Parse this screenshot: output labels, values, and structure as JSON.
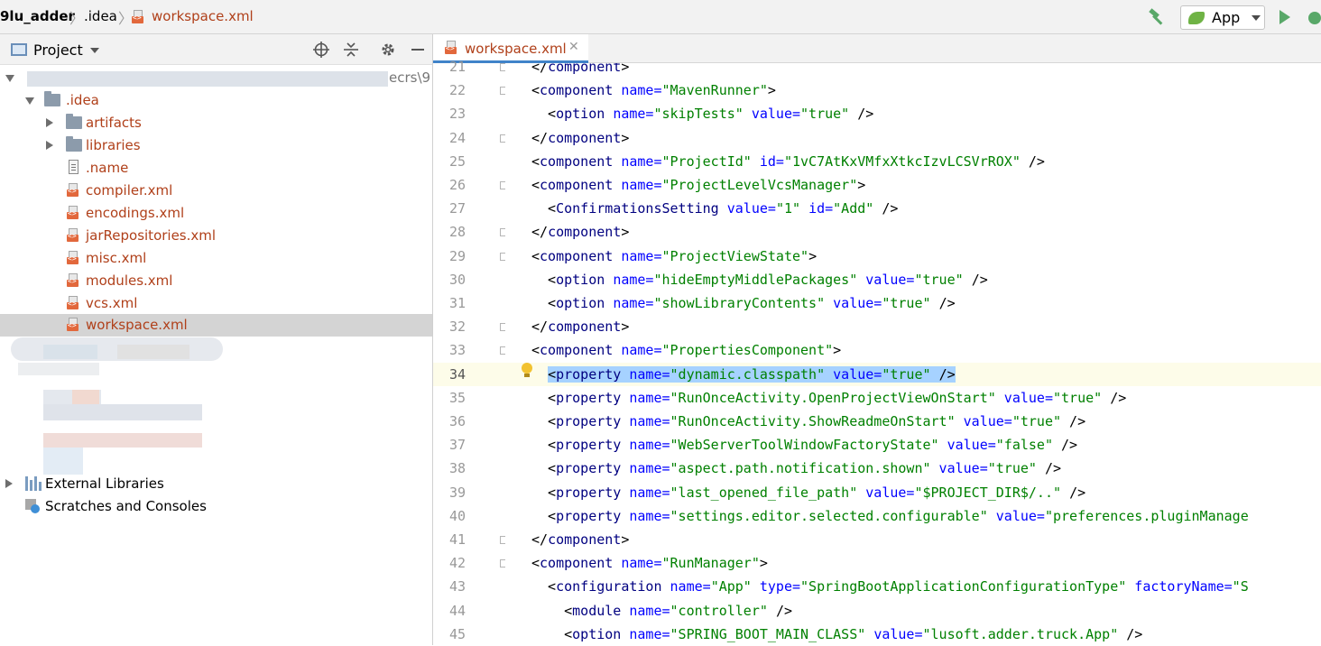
{
  "breadcrumb": {
    "project": "9lu_adder",
    "folder": ".idea",
    "file": "workspace.xml"
  },
  "toolbar": {
    "run_config": "App"
  },
  "project_panel": {
    "title": "Project",
    "root_suffix": "ecrs\\9",
    "tree": [
      {
        "label": ".idea",
        "kind": "folder",
        "expanded": true
      },
      {
        "label": "artifacts",
        "kind": "folder"
      },
      {
        "label": "libraries",
        "kind": "folder"
      },
      {
        "label": ".name",
        "kind": "text-file"
      },
      {
        "label": "compiler.xml",
        "kind": "xml-file"
      },
      {
        "label": "encodings.xml",
        "kind": "xml-file"
      },
      {
        "label": "jarRepositories.xml",
        "kind": "xml-file"
      },
      {
        "label": "misc.xml",
        "kind": "xml-file"
      },
      {
        "label": "modules.xml",
        "kind": "xml-file"
      },
      {
        "label": "vcs.xml",
        "kind": "xml-file"
      },
      {
        "label": "workspace.xml",
        "kind": "xml-file",
        "selected": true
      }
    ],
    "external_libraries": "External Libraries",
    "scratches": "Scratches and Consoles"
  },
  "editor": {
    "tab_title": "workspace.xml",
    "current_line": 34,
    "lines": [
      {
        "n": "21",
        "segs": [
          [
            "p",
            "</"
          ],
          [
            "t",
            "component"
          ],
          [
            "p",
            ">"
          ]
        ]
      },
      {
        "n": "22",
        "segs": [
          [
            "p",
            "<"
          ],
          [
            "t",
            "component "
          ],
          [
            "a",
            "name="
          ],
          [
            "v",
            "\"MavenRunner\""
          ],
          [
            "p",
            ">"
          ]
        ]
      },
      {
        "n": "23",
        "segs": [
          [
            "p",
            "  <"
          ],
          [
            "t",
            "option "
          ],
          [
            "a",
            "name="
          ],
          [
            "v",
            "\"skipTests\" "
          ],
          [
            "a",
            "value="
          ],
          [
            "v",
            "\"true\" "
          ],
          [
            "p",
            "/>"
          ]
        ]
      },
      {
        "n": "24",
        "segs": [
          [
            "p",
            "</"
          ],
          [
            "t",
            "component"
          ],
          [
            "p",
            ">"
          ]
        ]
      },
      {
        "n": "25",
        "segs": [
          [
            "p",
            "<"
          ],
          [
            "t",
            "component "
          ],
          [
            "a",
            "name="
          ],
          [
            "v",
            "\"ProjectId\" "
          ],
          [
            "a",
            "id="
          ],
          [
            "v",
            "\"1vC7AtKxVMfxXtkcIzvLCSVrROX\" "
          ],
          [
            "p",
            "/>"
          ]
        ]
      },
      {
        "n": "26",
        "segs": [
          [
            "p",
            "<"
          ],
          [
            "t",
            "component "
          ],
          [
            "a",
            "name="
          ],
          [
            "v",
            "\"ProjectLevelVcsManager\""
          ],
          [
            "p",
            ">"
          ]
        ]
      },
      {
        "n": "27",
        "segs": [
          [
            "p",
            "  <"
          ],
          [
            "t",
            "ConfirmationsSetting "
          ],
          [
            "a",
            "value="
          ],
          [
            "v",
            "\"1\" "
          ],
          [
            "a",
            "id="
          ],
          [
            "v",
            "\"Add\" "
          ],
          [
            "p",
            "/>"
          ]
        ]
      },
      {
        "n": "28",
        "segs": [
          [
            "p",
            "</"
          ],
          [
            "t",
            "component"
          ],
          [
            "p",
            ">"
          ]
        ]
      },
      {
        "n": "29",
        "segs": [
          [
            "p",
            "<"
          ],
          [
            "t",
            "component "
          ],
          [
            "a",
            "name="
          ],
          [
            "v",
            "\"ProjectViewState\""
          ],
          [
            "p",
            ">"
          ]
        ]
      },
      {
        "n": "30",
        "segs": [
          [
            "p",
            "  <"
          ],
          [
            "t",
            "option "
          ],
          [
            "a",
            "name="
          ],
          [
            "v",
            "\"hideEmptyMiddlePackages\" "
          ],
          [
            "a",
            "value="
          ],
          [
            "v",
            "\"true\" "
          ],
          [
            "p",
            "/>"
          ]
        ]
      },
      {
        "n": "31",
        "segs": [
          [
            "p",
            "  <"
          ],
          [
            "t",
            "option "
          ],
          [
            "a",
            "name="
          ],
          [
            "v",
            "\"showLibraryContents\" "
          ],
          [
            "a",
            "value="
          ],
          [
            "v",
            "\"true\" "
          ],
          [
            "p",
            "/>"
          ]
        ]
      },
      {
        "n": "32",
        "segs": [
          [
            "p",
            "</"
          ],
          [
            "t",
            "component"
          ],
          [
            "p",
            ">"
          ]
        ]
      },
      {
        "n": "33",
        "segs": [
          [
            "p",
            "<"
          ],
          [
            "t",
            "component "
          ],
          [
            "a",
            "name="
          ],
          [
            "v",
            "\"PropertiesComponent\""
          ],
          [
            "p",
            ">"
          ]
        ]
      },
      {
        "n": "34",
        "segs": [
          [
            "p",
            "  <"
          ],
          [
            "t",
            "property "
          ],
          [
            "a",
            "name="
          ],
          [
            "v",
            "\"dynamic.classpath\" "
          ],
          [
            "a",
            "value="
          ],
          [
            "v",
            "\"true\" "
          ],
          [
            "p",
            "/>"
          ]
        ],
        "highlight": true
      },
      {
        "n": "35",
        "segs": [
          [
            "p",
            "  <"
          ],
          [
            "t",
            "property "
          ],
          [
            "a",
            "name="
          ],
          [
            "v",
            "\"RunOnceActivity.OpenProjectViewOnStart\" "
          ],
          [
            "a",
            "value="
          ],
          [
            "v",
            "\"true\" "
          ],
          [
            "p",
            "/>"
          ]
        ]
      },
      {
        "n": "36",
        "segs": [
          [
            "p",
            "  <"
          ],
          [
            "t",
            "property "
          ],
          [
            "a",
            "name="
          ],
          [
            "v",
            "\"RunOnceActivity.ShowReadmeOnStart\" "
          ],
          [
            "a",
            "value="
          ],
          [
            "v",
            "\"true\" "
          ],
          [
            "p",
            "/>"
          ]
        ]
      },
      {
        "n": "37",
        "segs": [
          [
            "p",
            "  <"
          ],
          [
            "t",
            "property "
          ],
          [
            "a",
            "name="
          ],
          [
            "v",
            "\"WebServerToolWindowFactoryState\" "
          ],
          [
            "a",
            "value="
          ],
          [
            "v",
            "\"false\" "
          ],
          [
            "p",
            "/>"
          ]
        ]
      },
      {
        "n": "38",
        "segs": [
          [
            "p",
            "  <"
          ],
          [
            "t",
            "property "
          ],
          [
            "a",
            "name="
          ],
          [
            "v",
            "\"aspect.path.notification.shown\" "
          ],
          [
            "a",
            "value="
          ],
          [
            "v",
            "\"true\" "
          ],
          [
            "p",
            "/>"
          ]
        ]
      },
      {
        "n": "39",
        "segs": [
          [
            "p",
            "  <"
          ],
          [
            "t",
            "property "
          ],
          [
            "a",
            "name="
          ],
          [
            "v",
            "\"last_opened_file_path\" "
          ],
          [
            "a",
            "value="
          ],
          [
            "v",
            "\"$PROJECT_DIR$/..\" "
          ],
          [
            "p",
            "/>"
          ]
        ]
      },
      {
        "n": "40",
        "segs": [
          [
            "p",
            "  <"
          ],
          [
            "t",
            "property "
          ],
          [
            "a",
            "name="
          ],
          [
            "v",
            "\"settings.editor.selected.configurable\" "
          ],
          [
            "a",
            "value="
          ],
          [
            "v",
            "\"preferences.pluginManage"
          ]
        ]
      },
      {
        "n": "41",
        "segs": [
          [
            "p",
            "</"
          ],
          [
            "t",
            "component"
          ],
          [
            "p",
            ">"
          ]
        ]
      },
      {
        "n": "42",
        "segs": [
          [
            "p",
            "<"
          ],
          [
            "t",
            "component "
          ],
          [
            "a",
            "name="
          ],
          [
            "v",
            "\"RunManager\""
          ],
          [
            "p",
            ">"
          ]
        ]
      },
      {
        "n": "43",
        "segs": [
          [
            "p",
            "  <"
          ],
          [
            "t",
            "configuration "
          ],
          [
            "a",
            "name="
          ],
          [
            "v",
            "\"App\" "
          ],
          [
            "a",
            "type="
          ],
          [
            "v",
            "\"SpringBootApplicationConfigurationType\" "
          ],
          [
            "a",
            "factoryName="
          ],
          [
            "v",
            "\"S"
          ]
        ]
      },
      {
        "n": "44",
        "segs": [
          [
            "p",
            "    <"
          ],
          [
            "t",
            "module "
          ],
          [
            "a",
            "name="
          ],
          [
            "v",
            "\"controller\" "
          ],
          [
            "p",
            "/>"
          ]
        ]
      },
      {
        "n": "45",
        "segs": [
          [
            "p",
            "    <"
          ],
          [
            "t",
            "option "
          ],
          [
            "a",
            "name="
          ],
          [
            "v",
            "\"SPRING_BOOT_MAIN_CLASS\" "
          ],
          [
            "a",
            "value="
          ],
          [
            "v",
            "\"lusoft.adder.truck.App\" "
          ],
          [
            "p",
            "/>"
          ]
        ]
      }
    ]
  }
}
